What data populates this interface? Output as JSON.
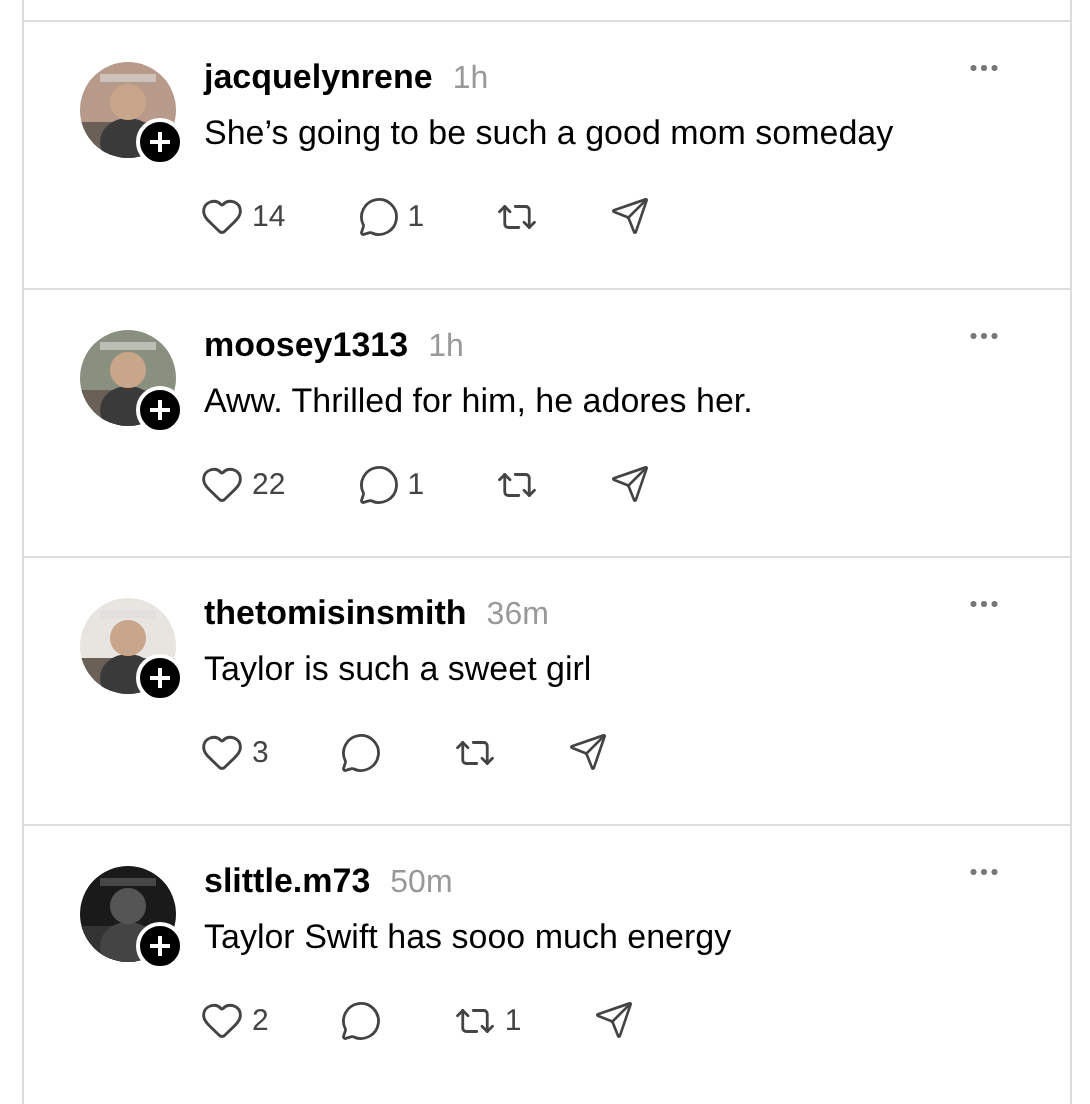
{
  "posts": [
    {
      "username": "jacquelynrene",
      "time": "1h",
      "text": "She’s going to be such a good mom someday",
      "likes": "14",
      "replies": "1"
    },
    {
      "username": "moosey1313",
      "time": "1h",
      "text": "Aww. Thrilled for him, he adores her.",
      "likes": "22",
      "replies": "1"
    },
    {
      "username": "thetomisinsmith",
      "time": "36m",
      "text": "Taylor is such a sweet girl",
      "likes": "3"
    },
    {
      "username": "slittle.m73",
      "time": "50m",
      "text": "Taylor Swift has sooo much energy",
      "likes": "2",
      "reposts": "1"
    }
  ]
}
